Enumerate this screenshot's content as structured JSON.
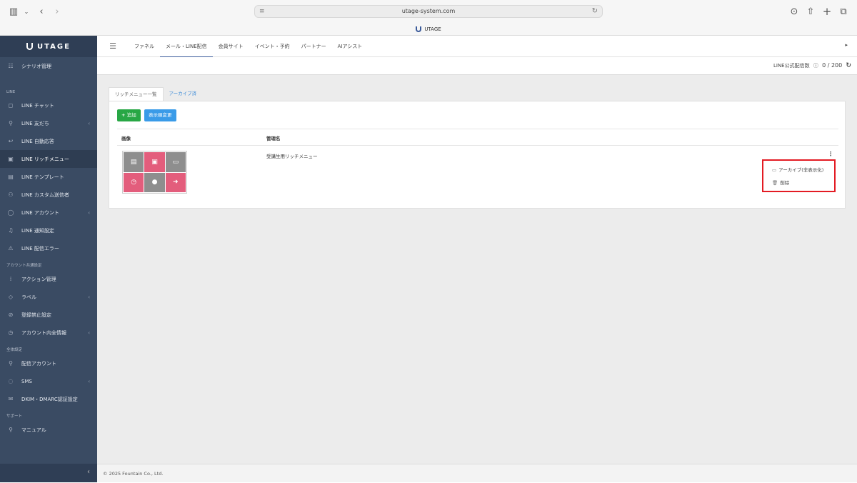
{
  "browser": {
    "url": "utage-system.com",
    "tab_title": "UTAGE"
  },
  "sidebar": {
    "logo": "UTAGE",
    "items": [
      {
        "label": "シナリオ管理",
        "icon": "list-icon"
      },
      {
        "section": "LINE"
      },
      {
        "label": "LINE チャット",
        "icon": "chat-icon"
      },
      {
        "label": "LINE 友だち",
        "icon": "person-icon",
        "chevron": true
      },
      {
        "label": "LINE 自動応答",
        "icon": "reply-icon"
      },
      {
        "label": "LINE リッチメニュー",
        "icon": "richmenu-icon",
        "active": true
      },
      {
        "label": "LINE テンプレート",
        "icon": "document-icon"
      },
      {
        "label": "LINE カスタム送信者",
        "icon": "users-icon"
      },
      {
        "label": "LINE アカウント",
        "icon": "account-icon",
        "chevron": true
      },
      {
        "label": "LINE 通知設定",
        "icon": "bell-icon"
      },
      {
        "label": "LINE 配信エラー",
        "icon": "warning-icon"
      },
      {
        "section": "アカウント共通設定"
      },
      {
        "label": "アクション管理",
        "icon": "grid-icon"
      },
      {
        "label": "ラベル",
        "icon": "tag-icon",
        "chevron": true
      },
      {
        "label": "登録禁止設定",
        "icon": "ban-icon"
      },
      {
        "label": "アカウント内全情報",
        "icon": "info-icon",
        "chevron": true
      },
      {
        "section": "全体設定"
      },
      {
        "label": "配信アカウント",
        "icon": "person-icon"
      },
      {
        "label": "SMS",
        "icon": "sms-icon",
        "chevron": true
      },
      {
        "label": "DKIM・DMARC認証設定",
        "icon": "mail-icon"
      },
      {
        "section": "サポート"
      },
      {
        "label": "マニュアル",
        "icon": "person-icon"
      }
    ],
    "collapse": "‹"
  },
  "topnav": {
    "tabs": [
      "ファネル",
      "メール・LINE配信",
      "会員サイト",
      "イベント・予約",
      "パートナー",
      "AIアシスト"
    ],
    "active_index": 1
  },
  "subbar": {
    "label": "LINE公式配信数",
    "count": "0 / 200"
  },
  "content": {
    "tabs": [
      "リッチメニュー一覧",
      "アーカイブ済"
    ],
    "add_button": "追加",
    "order_button": "表示順変更",
    "columns": [
      "画像",
      "管理名"
    ],
    "rows": [
      {
        "name": "受講生用リッチメニュー"
      }
    ],
    "dropdown": {
      "archive": "アーカイブ(非表示化)",
      "delete": "削除"
    }
  },
  "footer": {
    "copyright": "© 2025 Fountain Co., Ltd."
  },
  "colors": {
    "sidebar": "#3a4b63",
    "add": "#28a745",
    "order": "#3a9be8",
    "highlight": "#e31b23",
    "rich_pink": "#e35d7c",
    "rich_gray": "#8e8e8e"
  }
}
